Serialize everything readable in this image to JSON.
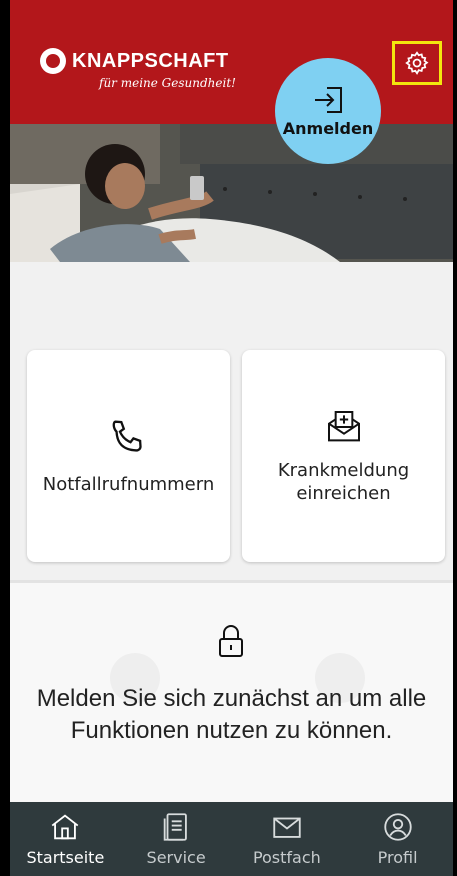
{
  "brand": {
    "name": "KNAPPSCHAFT",
    "tagline": "für meine Gesundheit!"
  },
  "header": {
    "login_label": "Anmelden",
    "settings_icon": "gear-icon"
  },
  "hero": {
    "alt": ""
  },
  "cards": [
    {
      "label": "Notfallrufnummern",
      "icon": "phone-icon"
    },
    {
      "label": "Krankmeldung einreichen",
      "icon": "envelope-plus-icon"
    }
  ],
  "locked": {
    "message": "Melden Sie sich zunächst an um alle Funktionen nutzen zu können.",
    "icon": "lock-icon"
  },
  "nav": [
    {
      "label": "Startseite",
      "icon": "home-icon",
      "active": true
    },
    {
      "label": "Service",
      "icon": "document-icon",
      "active": false
    },
    {
      "label": "Postfach",
      "icon": "mail-icon",
      "active": false
    },
    {
      "label": "Profil",
      "icon": "user-icon",
      "active": false
    }
  ],
  "colors": {
    "brand_red": "#b3171b",
    "login_blue": "#7fd0f2",
    "nav_bg": "#2f3a3d",
    "highlight": "#f3e60e"
  }
}
